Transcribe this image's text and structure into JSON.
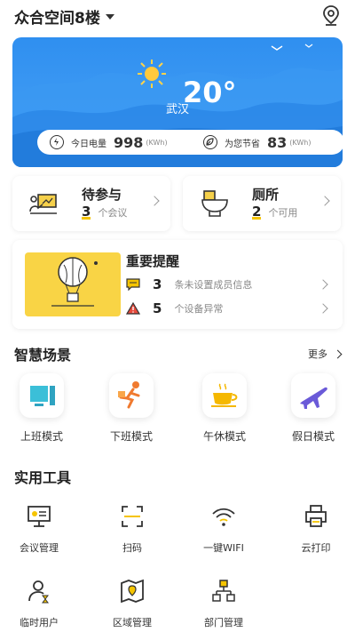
{
  "header": {
    "location": "众合空间8楼"
  },
  "weather": {
    "temperature": "20°",
    "city": "武汉",
    "power_today_label": "今日电量",
    "power_today_value": "998",
    "power_today_unit": "(KWh)",
    "saving_label": "为您节省",
    "saving_value": "83",
    "saving_unit": "(KWh)"
  },
  "quick": [
    {
      "title": "待参与",
      "count": "3",
      "suffix": "个会议"
    },
    {
      "title": "厕所",
      "count": "2",
      "suffix": "个可用"
    }
  ],
  "reminder": {
    "title": "重要提醒",
    "items": [
      {
        "count": "3",
        "text": "条未设置成员信息"
      },
      {
        "count": "5",
        "text": "个设备异常"
      }
    ]
  },
  "scenes": {
    "title": "智慧场景",
    "more": "更多",
    "items": [
      {
        "label": "上班模式",
        "icon": "computer-icon"
      },
      {
        "label": "下班模式",
        "icon": "running-man-icon"
      },
      {
        "label": "午休模式",
        "icon": "coffee-icon"
      },
      {
        "label": "假日模式",
        "icon": "airplane-icon"
      }
    ]
  },
  "tools": {
    "title": "实用工具",
    "items": [
      {
        "label": "会议管理",
        "icon": "meeting-icon"
      },
      {
        "label": "扫码",
        "icon": "scan-icon"
      },
      {
        "label": "一键WIFI",
        "icon": "wifi-icon"
      },
      {
        "label": "云打印",
        "icon": "printer-icon"
      },
      {
        "label": "临时用户",
        "icon": "temp-user-icon"
      },
      {
        "label": "区域管理",
        "icon": "map-icon"
      },
      {
        "label": "部门管理",
        "icon": "org-chart-icon"
      }
    ]
  },
  "colors": {
    "accent_blue": "#2f8ff0",
    "accent_yellow": "#f5c400"
  }
}
